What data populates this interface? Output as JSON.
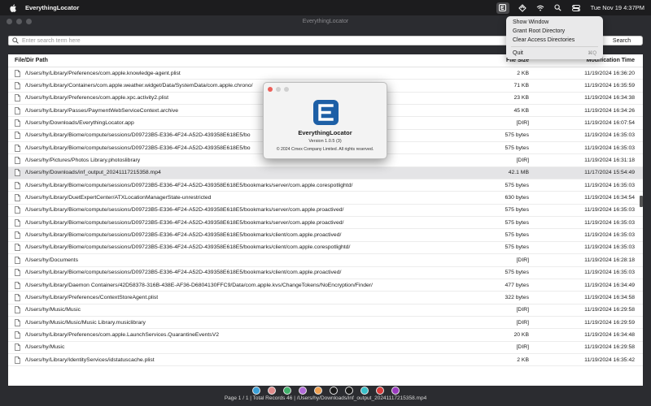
{
  "menubar": {
    "app_name": "EverythingLocator",
    "clock": "Tue Nov 19  4:37PM"
  },
  "window": {
    "title": "EverythingLocator"
  },
  "search": {
    "placeholder": "Enter search term here",
    "button_label": "Search"
  },
  "table": {
    "headers": {
      "path": "File/Dir Path",
      "size": "File Size",
      "time": "Modification Time"
    },
    "rows": [
      {
        "path": "/Users/hy/Library/Preferences/com.apple.knowledge-agent.plist",
        "size": "2 KB",
        "time": "11/19/2024 16:36:20"
      },
      {
        "path": "/Users/hy/Library/Containers/com.apple.weather.widget/Data/SystemData/com.apple.chrono/",
        "size": "71 KB",
        "time": "11/19/2024 16:35:59"
      },
      {
        "path": "/Users/hy/Library/Preferences/com.apple.xpc.activity2.plist",
        "size": "23 KB",
        "time": "11/19/2024 16:34:38"
      },
      {
        "path": "/Users/hy/Library/Passes/PaymentWebServiceContext.archive",
        "size": "45 KB",
        "time": "11/19/2024 16:34:26"
      },
      {
        "path": "/Users/hy/Downloads/EverythingLocator.app",
        "size": "[DIR]",
        "time": "11/19/2024 16:07:54"
      },
      {
        "path": "/Users/hy/Library/Biome/compute/sessions/D09723B5-E336-4F24-A52D-439358E618E5/bo",
        "size": "575 bytes",
        "time": "11/19/2024 16:35:03"
      },
      {
        "path": "/Users/hy/Library/Biome/compute/sessions/D09723B5-E336-4F24-A52D-439358E618E5/bo",
        "size": "575 bytes",
        "time": "11/19/2024 16:35:03"
      },
      {
        "path": "/Users/hy/Pictures/Photos Library.photoslibrary",
        "size": "[DIR]",
        "time": "11/19/2024 16:31:18"
      },
      {
        "path": "/Users/hy/Downloads/inf_output_20241117215358.mp4",
        "size": "42.1 MB",
        "time": "11/17/2024 15:54:49"
      },
      {
        "path": "/Users/hy/Library/Biome/compute/sessions/D09723B5-E336-4F24-A52D-439358E618E5/bookmarks/server/com.apple.corespotlightd/",
        "size": "575 bytes",
        "time": "11/19/2024 16:35:03"
      },
      {
        "path": "/Users/hy/Library/DuetExpertCenter/ATXLocationManagerState-unrestricted",
        "size": "630 bytes",
        "time": "11/19/2024 16:34:54"
      },
      {
        "path": "/Users/hy/Library/Biome/compute/sessions/D09723B5-E336-4F24-A52D-439358E618E5/bookmarks/server/com.apple.proactived/",
        "size": "575 bytes",
        "time": "11/19/2024 16:35:03"
      },
      {
        "path": "/Users/hy/Library/Biome/compute/sessions/D09723B5-E336-4F24-A52D-439358E618E5/bookmarks/server/com.apple.proactived/",
        "size": "575 bytes",
        "time": "11/19/2024 16:35:03"
      },
      {
        "path": "/Users/hy/Library/Biome/compute/sessions/D09723B5-E336-4F24-A52D-439358E618E5/bookmarks/client/com.apple.proactived/",
        "size": "575 bytes",
        "time": "11/19/2024 16:35:03"
      },
      {
        "path": "/Users/hy/Library/Biome/compute/sessions/D09723B5-E336-4F24-A52D-439358E618E5/bookmarks/client/com.apple.corespotlightd/",
        "size": "575 bytes",
        "time": "11/19/2024 16:35:03"
      },
      {
        "path": "/Users/hy/Documents",
        "size": "[DIR]",
        "time": "11/19/2024 16:28:18"
      },
      {
        "path": "/Users/hy/Library/Biome/compute/sessions/D09723B5-E336-4F24-A52D-439358E618E5/bookmarks/client/com.apple.proactived/",
        "size": "575 bytes",
        "time": "11/19/2024 16:35:03"
      },
      {
        "path": "/Users/hy/Library/Daemon Containers/42D58378-316B-438E-AF36-D6804130FFC9/Data/com.apple.kvs/ChangeTokens/NoEncryption/Finder/",
        "size": "477 bytes",
        "time": "11/19/2024 16:34:49"
      },
      {
        "path": "/Users/hy/Library/Preferences/ContextStoreAgent.plist",
        "size": "322 bytes",
        "time": "11/19/2024 16:34:58"
      },
      {
        "path": "/Users/hy/Music/Music",
        "size": "[DIR]",
        "time": "11/19/2024 16:29:58"
      },
      {
        "path": "/Users/hy/Music/Music/Music Library.musiclibrary",
        "size": "[DIR]",
        "time": "11/19/2024 16:29:59"
      },
      {
        "path": "/Users/hy/Library/Preferences/com.apple.LaunchServices.QuarantineEventsV2",
        "size": "20 KB",
        "time": "11/19/2024 16:34:48"
      },
      {
        "path": "/Users/hy/Music",
        "size": "[DIR]",
        "time": "11/19/2024 16:29:58"
      },
      {
        "path": "/Users/hy/Library/IdentityServices/idstatuscache.plist",
        "size": "2 KB",
        "time": "11/19/2024 16:35:42"
      }
    ],
    "selected_index": 8
  },
  "color_swatches": [
    "#3aa0d8",
    "#e08a8a",
    "#3fb06a",
    "#b06ad8",
    "#f0a050",
    "#1a1a1a",
    "#1a1a1a",
    "#38c0c8",
    "#d83a3a",
    "#9a3ac0"
  ],
  "status_text": "Page 1 / 1 | Total Records 46 | /Users/hy/Downloads/inf_output_20241117215358.mp4",
  "about": {
    "name": "EverythingLocator",
    "version": "Version 1.0.5 (3)",
    "copyright": "© 2024 Crnex Company Limited. All rights reserved."
  },
  "menu": {
    "items": [
      "Show Window",
      "Grant Root Directory",
      "Clear Access Directories"
    ],
    "quit_label": "Quit",
    "quit_shortcut": "⌘Q"
  },
  "colors": {
    "brand_blue": "#1d5fa6",
    "close_red": "#ec5f59",
    "selection": "#e4e4e6"
  }
}
